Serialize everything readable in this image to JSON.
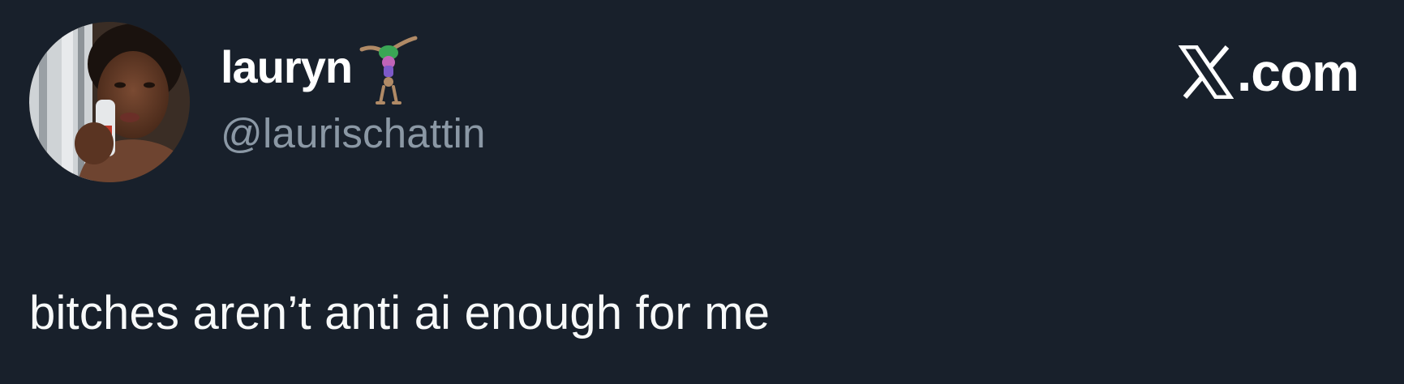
{
  "author": {
    "display_name": "lauryn",
    "name_emoji": "person-doing-cartwheel-emoji",
    "handle": "@laurischattin",
    "avatar": "profile-photo-avatar"
  },
  "brand": {
    "icon": "x-logo-icon",
    "suffix": ".com"
  },
  "tweet": {
    "text": "bitches aren’t anti ai enough for me"
  },
  "colors": {
    "background": "#18202b",
    "primary_text": "#ffffff",
    "secondary_text": "#8b98a5"
  }
}
